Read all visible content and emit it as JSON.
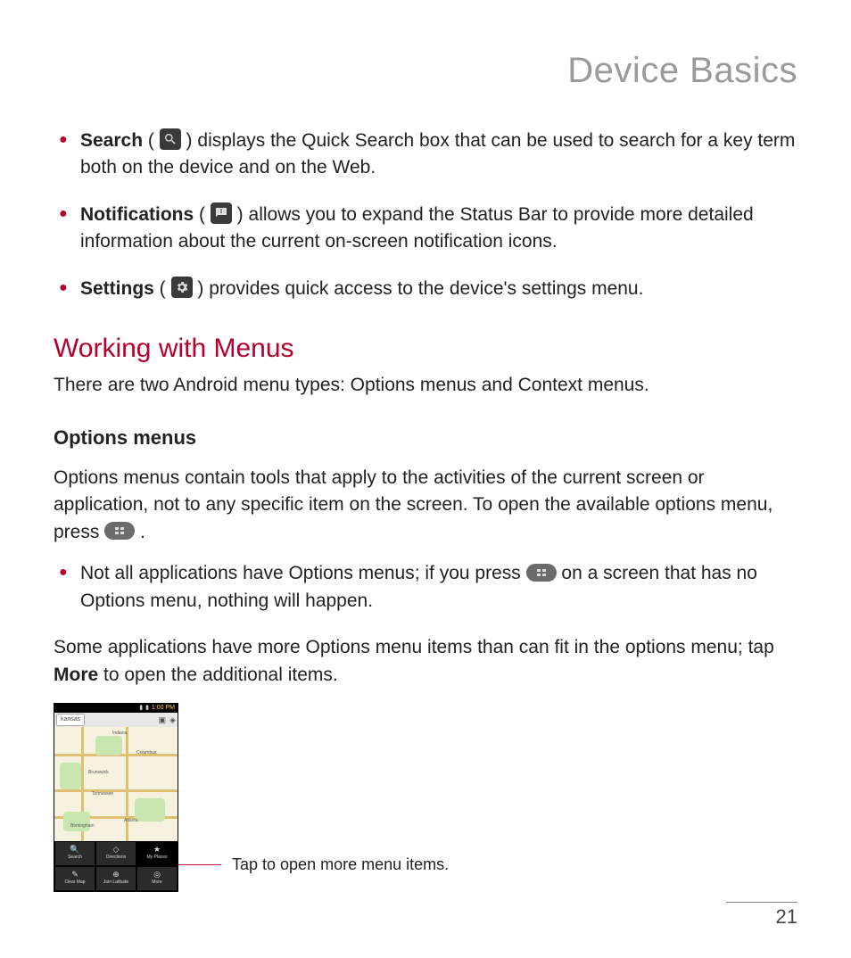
{
  "header": {
    "title": "Device Basics"
  },
  "bullets": [
    {
      "label": "Search",
      "open": " ( ",
      "close": " ) ",
      "text": "displays the Quick Search box that can be used to search for a key term both on the device and on the Web."
    },
    {
      "label": "Notifications",
      "open": " ( ",
      "close": " ) ",
      "text": "allows you to expand the Status Bar to provide more detailed information about the current on-screen notification icons."
    },
    {
      "label": "Settings",
      "open": " ( ",
      "close": " ) ",
      "text": "provides quick access to the device's settings menu."
    }
  ],
  "section": {
    "title": "Working with Menus",
    "intro": "There are two Android menu types: Options menus and Context menus."
  },
  "options": {
    "heading": "Options menus",
    "para1_a": "Options menus contain tools that apply to the activities of the current screen or application, not to any specific item on the screen. To open the available options menu, press ",
    "para1_b": " .",
    "bullet_a": "Not all applications have Options menus; if you press ",
    "bullet_b": " on a screen that has no Options menu, nothing will happen.",
    "para2_a": "Some applications have more Options menu items than can fit in the options menu; tap ",
    "more_word": "More",
    "para2_b": " to open the additional items."
  },
  "callout": {
    "text": "Tap to open more menu items."
  },
  "screenshot": {
    "status_time": "1:00 PM",
    "search_text": "kansas",
    "cities": [
      "Indiana",
      "Columbus",
      "Brunswick",
      "Tennessee",
      "Birmingham",
      "Atlanta"
    ],
    "city_pos": [
      {
        "l": 65,
        "t": 4
      },
      {
        "l": 92,
        "t": 26
      },
      {
        "l": 38,
        "t": 48
      },
      {
        "l": 42,
        "t": 72
      },
      {
        "l": 18,
        "t": 108
      },
      {
        "l": 78,
        "t": 102
      }
    ],
    "menu": [
      {
        "icon": "🔍",
        "label": "Search"
      },
      {
        "icon": "◇",
        "label": "Directions"
      },
      {
        "icon": "★",
        "label": "My Places"
      },
      {
        "icon": "✎",
        "label": "Clear Map"
      },
      {
        "icon": "⊕",
        "label": "Join Latitude"
      },
      {
        "icon": "◎",
        "label": "More"
      }
    ]
  },
  "page_number": "21"
}
